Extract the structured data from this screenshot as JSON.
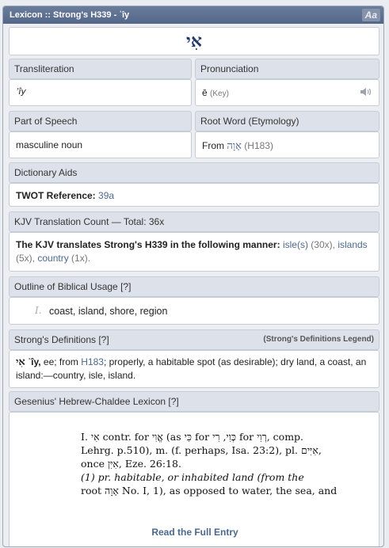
{
  "window": {
    "title": "Lexicon :: Strong's H339 - ʾîy",
    "font_button": "Aa"
  },
  "headword": "אִי",
  "transliteration": {
    "label": "Transliteration",
    "value": "ʾîy"
  },
  "pronunciation": {
    "label": "Pronunciation",
    "value": "ē",
    "key": "(Key)",
    "icon": "speaker-icon"
  },
  "part_of_speech": {
    "label": "Part of Speech",
    "value": "masculine noun"
  },
  "root_word": {
    "label": "Root Word (Etymology)",
    "prefix": "From",
    "hebrew": "אָוָה",
    "ref": "(H183)"
  },
  "dictionary_aids": {
    "label": "Dictionary Aids",
    "twot_label": "TWOT Reference:",
    "twot_value": "39a"
  },
  "kjv_count": {
    "label": "KJV Translation Count — Total: 36x",
    "intro": "The KJV translates Strong's H339 in the following manner:",
    "item1": "isle(s)",
    "item1_count": "(30x),",
    "item2": "islands",
    "item2_count": "(5x),",
    "item3": "country",
    "item3_count": "(1x)."
  },
  "outline": {
    "label": "Outline of Biblical Usage [?]",
    "numeral": "I.",
    "text": "coast, island, shore, region"
  },
  "strongs": {
    "label": "Strong's Definitions [?]",
    "legend": "(Strong's Definitions Legend)",
    "hebrew": "אִי",
    "translit": "ʾîy,",
    "pron": "ee; from",
    "ref": "H183",
    "text_rest": "; properly, a habitable spot (as desirable); dry land, a coast, an",
    "line2": "island:—country, isle, island."
  },
  "gesenius": {
    "label": "Gesenius' Hebrew-Chaldee Lexicon [?]",
    "line1": "I. אִי contr. for אֱוִי (as כִּי for כְּוִי, רִי for רְוִי, comp.",
    "line2": "Lehrg. p.510), m. (f. perhaps, Isa. 23:2), pl. אִיִּים,",
    "line3": "once אִיִּן, Eze. 26:18.",
    "line4": "(1) pr. habitable, or inhabited land (from the",
    "line5": "root אָוָה No. I, 1), as opposed to water, the sea, and",
    "read_more": "Read the Full Entry"
  }
}
